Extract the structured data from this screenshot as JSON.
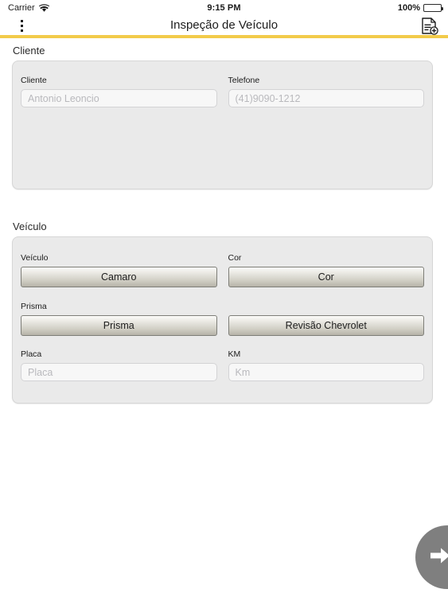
{
  "status_bar": {
    "carrier": "Carrier",
    "wifi_icon": "wifi-icon",
    "time": "9:15 PM",
    "battery_percent": "100%",
    "battery_icon": "battery-full-icon"
  },
  "nav_bar": {
    "menu_icon": "overflow-menu-icon",
    "title": "Inspeção de Veículo",
    "action_icon": "add-document-icon",
    "accent_color": "#f2cb4a"
  },
  "sections": {
    "cliente": {
      "title": "Cliente",
      "fields": {
        "cliente": {
          "label": "Cliente",
          "value": "",
          "placeholder": "Antonio Leoncio"
        },
        "telefone": {
          "label": "Telefone",
          "value": "",
          "placeholder": "(41)9090-1212"
        }
      }
    },
    "veiculo": {
      "title": "Veículo",
      "fields": {
        "veiculo": {
          "label": "Veículo",
          "button_label": "Camaro"
        },
        "cor": {
          "label": "Cor",
          "button_label": "Cor"
        },
        "prisma": {
          "label": "Prisma",
          "button_label": "Prisma"
        },
        "revisao": {
          "label": "",
          "button_label": "Revisão Chevrolet"
        },
        "placa": {
          "label": "Placa",
          "value": "",
          "placeholder": "Placa"
        },
        "km": {
          "label": "KM",
          "value": "",
          "placeholder": "Km"
        }
      }
    }
  },
  "fab": {
    "icon": "arrow-right-icon",
    "color": "#7f7f7f"
  }
}
